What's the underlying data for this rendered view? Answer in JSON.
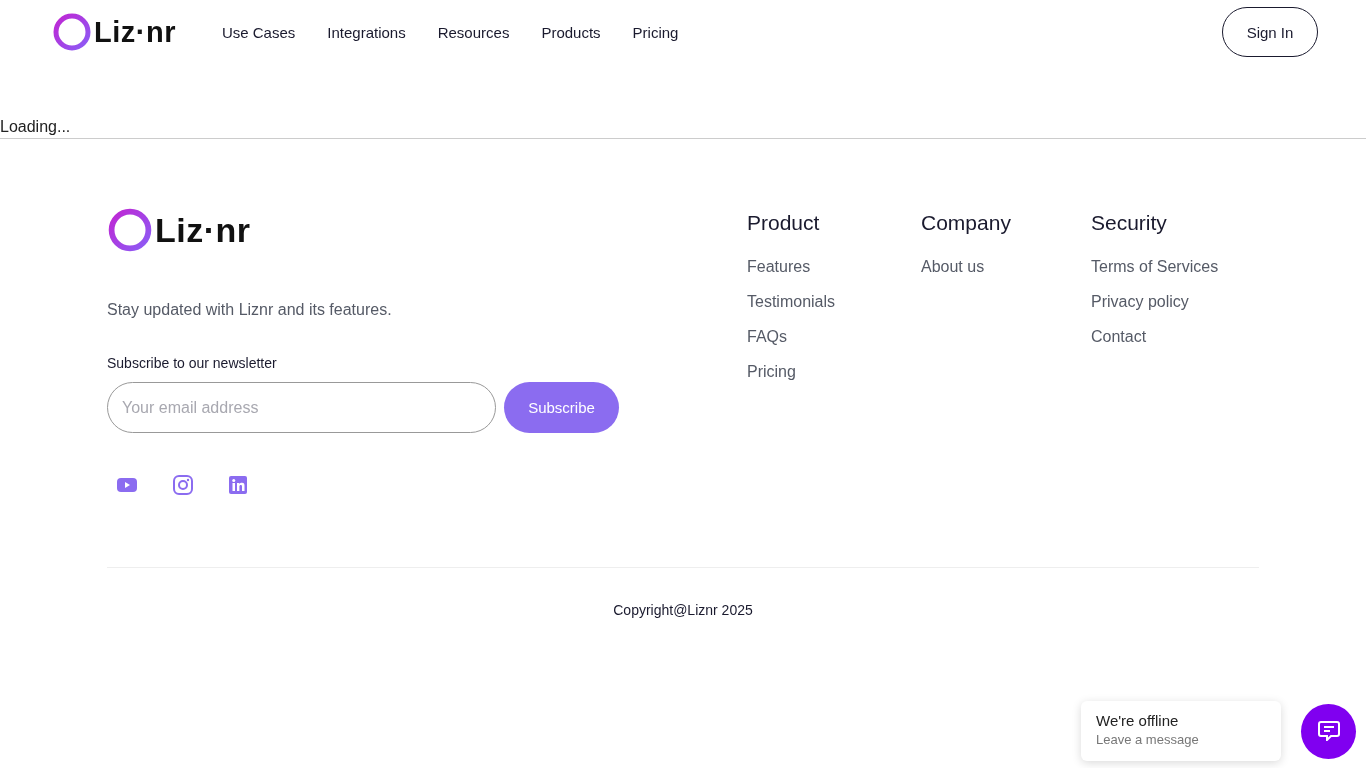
{
  "header": {
    "logo": "Liz·nr",
    "nav": [
      "Use Cases",
      "Integrations",
      "Resources",
      "Products",
      "Pricing"
    ],
    "sign_in": "Sign In"
  },
  "loading": "Loading...",
  "footer": {
    "logo": "Liz·nr",
    "tagline": "Stay updated with Liznr and its features.",
    "newsletter": {
      "label": "Subscribe to our newsletter",
      "placeholder": "Your email address",
      "button": "Subscribe"
    },
    "social": [
      {
        "kind": "youtube"
      },
      {
        "kind": "instagram"
      },
      {
        "kind": "linkedin"
      }
    ],
    "columns": [
      {
        "title": "Product",
        "links": [
          "Features",
          "Testimonials",
          "FAQs",
          "Pricing"
        ]
      },
      {
        "title": "Company",
        "links": [
          "About us"
        ]
      },
      {
        "title": "Security",
        "links": [
          "Terms of Services",
          "Privacy policy",
          "Contact"
        ]
      }
    ],
    "copyright": "Copyright@Liznr 2025"
  },
  "chat": {
    "title": "We're offline",
    "subtitle": "Leave a message"
  }
}
